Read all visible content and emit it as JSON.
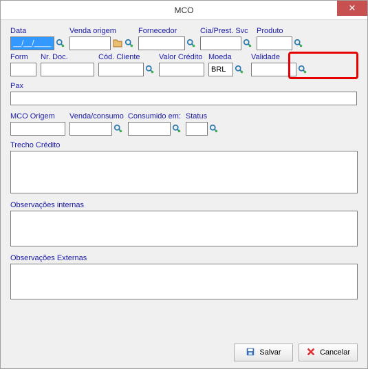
{
  "window": {
    "title": "MCO"
  },
  "row1": {
    "data": {
      "label": "Data",
      "value": "__/__/____"
    },
    "venda_origem": {
      "label": "Venda origem",
      "value": ""
    },
    "fornecedor": {
      "label": "Fornecedor",
      "value": ""
    },
    "cia": {
      "label": "Cia/Prest. Svc",
      "value": ""
    },
    "produto": {
      "label": "Produto",
      "value": ""
    }
  },
  "row2": {
    "form": {
      "label": "Form",
      "value": ""
    },
    "nrdoc": {
      "label": "Nr. Doc.",
      "value": ""
    },
    "codcliente": {
      "label": "Cód. Cliente",
      "value": ""
    },
    "valor": {
      "label": "Valor Crédito",
      "value": ""
    },
    "moeda": {
      "label": "Moeda",
      "value": "BRL"
    },
    "validade": {
      "label": "Validade",
      "value": ""
    }
  },
  "pax": {
    "label": "Pax",
    "value": ""
  },
  "row3": {
    "mcoorigem": {
      "label": "MCO Origem",
      "value": ""
    },
    "vendaconsumo": {
      "label": "Venda/consumo",
      "value": ""
    },
    "consumido": {
      "label": "Consumido em:",
      "value": ""
    },
    "status": {
      "label": "Status",
      "value": ""
    }
  },
  "trecho": {
    "label": "Trecho Crédito",
    "value": ""
  },
  "obsint": {
    "label": "Observações internas",
    "value": ""
  },
  "obsext": {
    "label": "Observações Externas",
    "value": ""
  },
  "buttons": {
    "save": "Salvar",
    "cancel": "Cancelar"
  }
}
